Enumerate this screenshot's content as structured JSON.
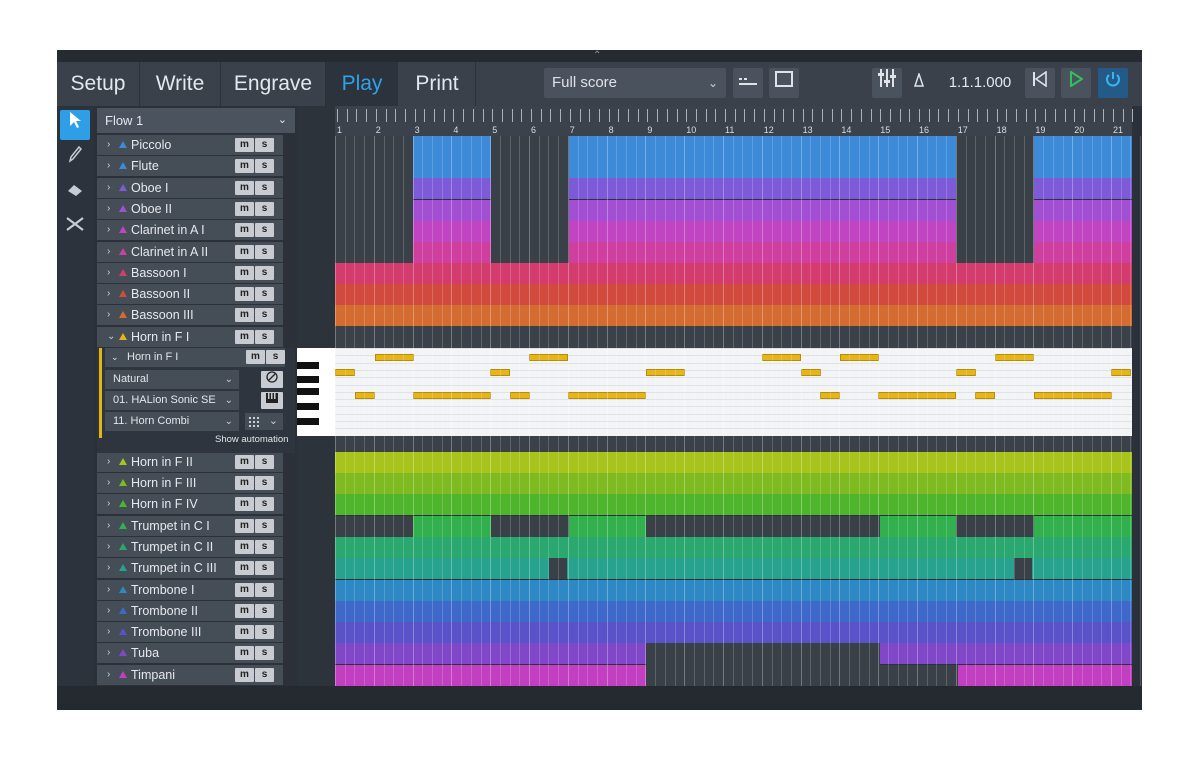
{
  "modes": [
    "Setup",
    "Write",
    "Engrave",
    "Play",
    "Print"
  ],
  "active_mode": "Play",
  "layout": {
    "selected": "Full score"
  },
  "transport": {
    "timecode": "1.1.1.000"
  },
  "flow": {
    "selected": "Flow 1"
  },
  "tracks": [
    {
      "name": "Piccolo",
      "color": "#3c8ad8"
    },
    {
      "name": "Flute",
      "color": "#3c8ad8"
    },
    {
      "name": "Oboe I",
      "color": "#7d5ad8"
    },
    {
      "name": "Oboe II",
      "color": "#a24fd4"
    },
    {
      "name": "Clarinet in A I",
      "color": "#c144c2"
    },
    {
      "name": "Clarinet in A II",
      "color": "#cf3fa0"
    },
    {
      "name": "Bassoon I",
      "color": "#d33c6c"
    },
    {
      "name": "Bassoon II",
      "color": "#d24a3e"
    },
    {
      "name": "Bassoon III",
      "color": "#d46c32"
    },
    {
      "name": "Horn in F I",
      "color": "#e5b515"
    },
    {
      "name": "Horn in F II",
      "color": "#a8c41c"
    },
    {
      "name": "Horn in F III",
      "color": "#7fbb20"
    },
    {
      "name": "Horn in F IV",
      "color": "#4fb52c"
    },
    {
      "name": "Trumpet in C I",
      "color": "#33b04e"
    },
    {
      "name": "Trumpet in C II",
      "color": "#2aa86f"
    },
    {
      "name": "Trumpet in C III",
      "color": "#26a28e"
    },
    {
      "name": "Trombone I",
      "color": "#2d88c4"
    },
    {
      "name": "Trombone II",
      "color": "#3e68c9"
    },
    {
      "name": "Trombone III",
      "color": "#5a52c9"
    },
    {
      "name": "Tuba",
      "color": "#8048c8"
    },
    {
      "name": "Timpani",
      "color": "#c13fc0"
    }
  ],
  "ms_labels": {
    "mute": "m",
    "solo": "s"
  },
  "expanded": {
    "track": "Horn in F I",
    "technique": "Natural",
    "instrument": "01. HALion Sonic SE",
    "patch": "11. Horn Combi",
    "show_automation": "Show automation"
  },
  "ruler": [
    "1",
    "2",
    "3",
    "4",
    "5",
    "6",
    "7",
    "8",
    "9",
    "10",
    "11",
    "12",
    "13",
    "14",
    "15",
    "16",
    "17",
    "18",
    "19",
    "20",
    "21"
  ],
  "colors": {
    "accent": "#2ea3e8",
    "play_green": "#2fc25a",
    "note_fill": "#e6b51a"
  }
}
